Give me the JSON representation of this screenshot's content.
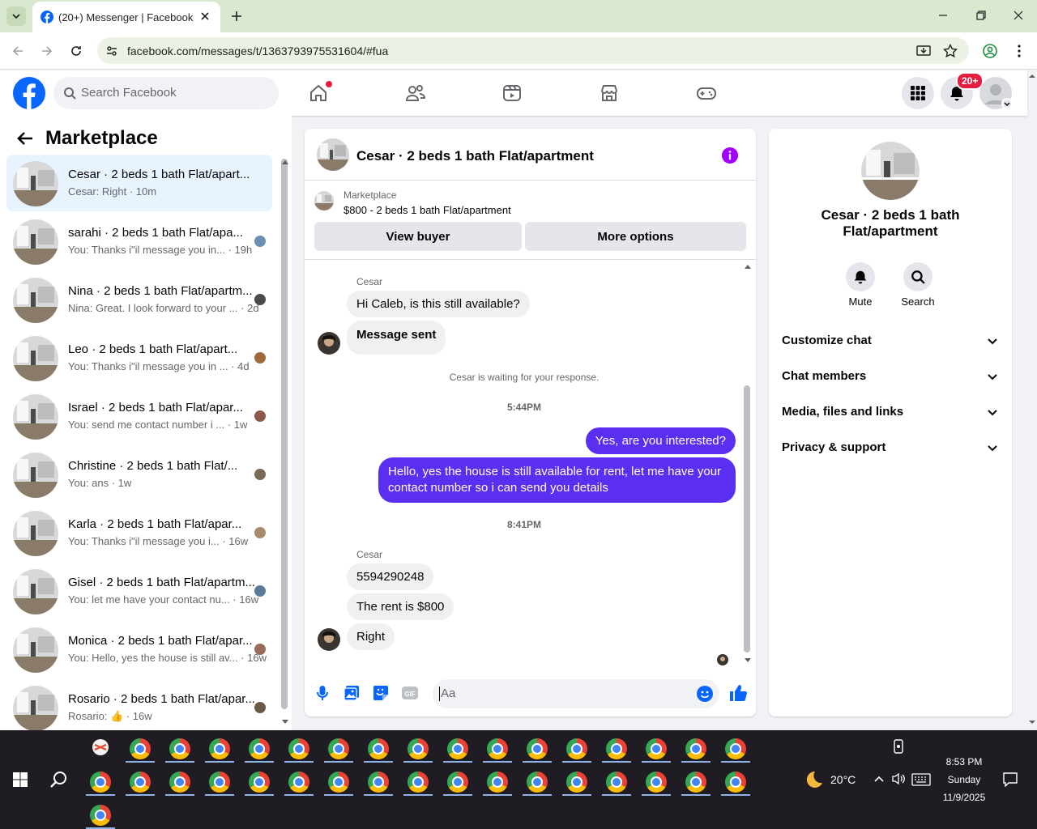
{
  "browser": {
    "tab_title": "(20+) Messenger | Facebook",
    "url": "facebook.com/messages/t/1363793975531604/#fua"
  },
  "fb": {
    "search_placeholder": "Search Facebook",
    "notif_count": "20+"
  },
  "sidebar": {
    "title": "Marketplace",
    "conversations": [
      {
        "name": "Cesar · 2 beds 1 bath Flat/apart...",
        "preview": "Cesar: Right · 10m",
        "selected": true
      },
      {
        "name": "sarahi · 2 beds 1 bath Flat/apa...",
        "preview": "You: Thanks i\"il message you in... · 19h"
      },
      {
        "name": "Nina · 2 beds 1 bath Flat/apartm...",
        "preview": "Nina: Great. I look forward to your ... · 2d"
      },
      {
        "name": "Leo · 2 beds 1 bath Flat/apart...",
        "preview": "You: Thanks i\"il message you in ... · 4d"
      },
      {
        "name": "Israel · 2 beds 1 bath Flat/apar...",
        "preview": "You: send me contact number i ... · 1w"
      },
      {
        "name": "Christine · 2 beds 1 bath Flat/...",
        "preview": "You: ans · 1w"
      },
      {
        "name": "Karla · 2 beds 1 bath Flat/apar...",
        "preview": "You: Thanks i\"il message you i... · 16w"
      },
      {
        "name": "Gisel · 2 beds 1 bath Flat/apartm...",
        "preview": "You: let me have your contact nu... · 16w"
      },
      {
        "name": "Monica · 2 beds 1 bath Flat/apar...",
        "preview": "You: Hello, yes the house is still av... · 16w"
      },
      {
        "name": "Rosario · 2 beds 1 bath Flat/apar...",
        "preview": "Rosario: 👍 · 16w"
      }
    ]
  },
  "chat": {
    "title": "Cesar · 2 beds 1 bath Flat/apartment",
    "listing_source": "Marketplace",
    "listing": "$800 - 2 beds 1 bath Flat/apartment",
    "view_buyer": "View buyer",
    "more_options": "More options",
    "sender1": "Cesar",
    "msg1": "Hi Caleb, is this still available?",
    "msg2": "Message sent",
    "waiting": "Cesar is waiting for your response.",
    "time1": "5:44PM",
    "out1": "Yes, are you interested?",
    "out2": "Hello, yes the house is still available for rent, let me have your contact number so i can send you details",
    "time2": "8:41PM",
    "sender2": "Cesar",
    "msg3": "5594290248",
    "msg4": "The rent is $800",
    "msg5": "Right",
    "composer_placeholder": "Aa"
  },
  "info": {
    "name": "Cesar · 2 beds 1 bath Flat/apartment",
    "mute": "Mute",
    "search": "Search",
    "sections": [
      "Customize chat",
      "Chat members",
      "Media, files and links",
      "Privacy & support"
    ]
  },
  "taskbar": {
    "weather": "20°C",
    "time": "8:53 PM",
    "day": "Sunday",
    "date": "11/9/2025"
  },
  "colors": {
    "accent": "#5b2ff2",
    "fb_blue": "#0866ff",
    "badge": "#e41e3f"
  }
}
